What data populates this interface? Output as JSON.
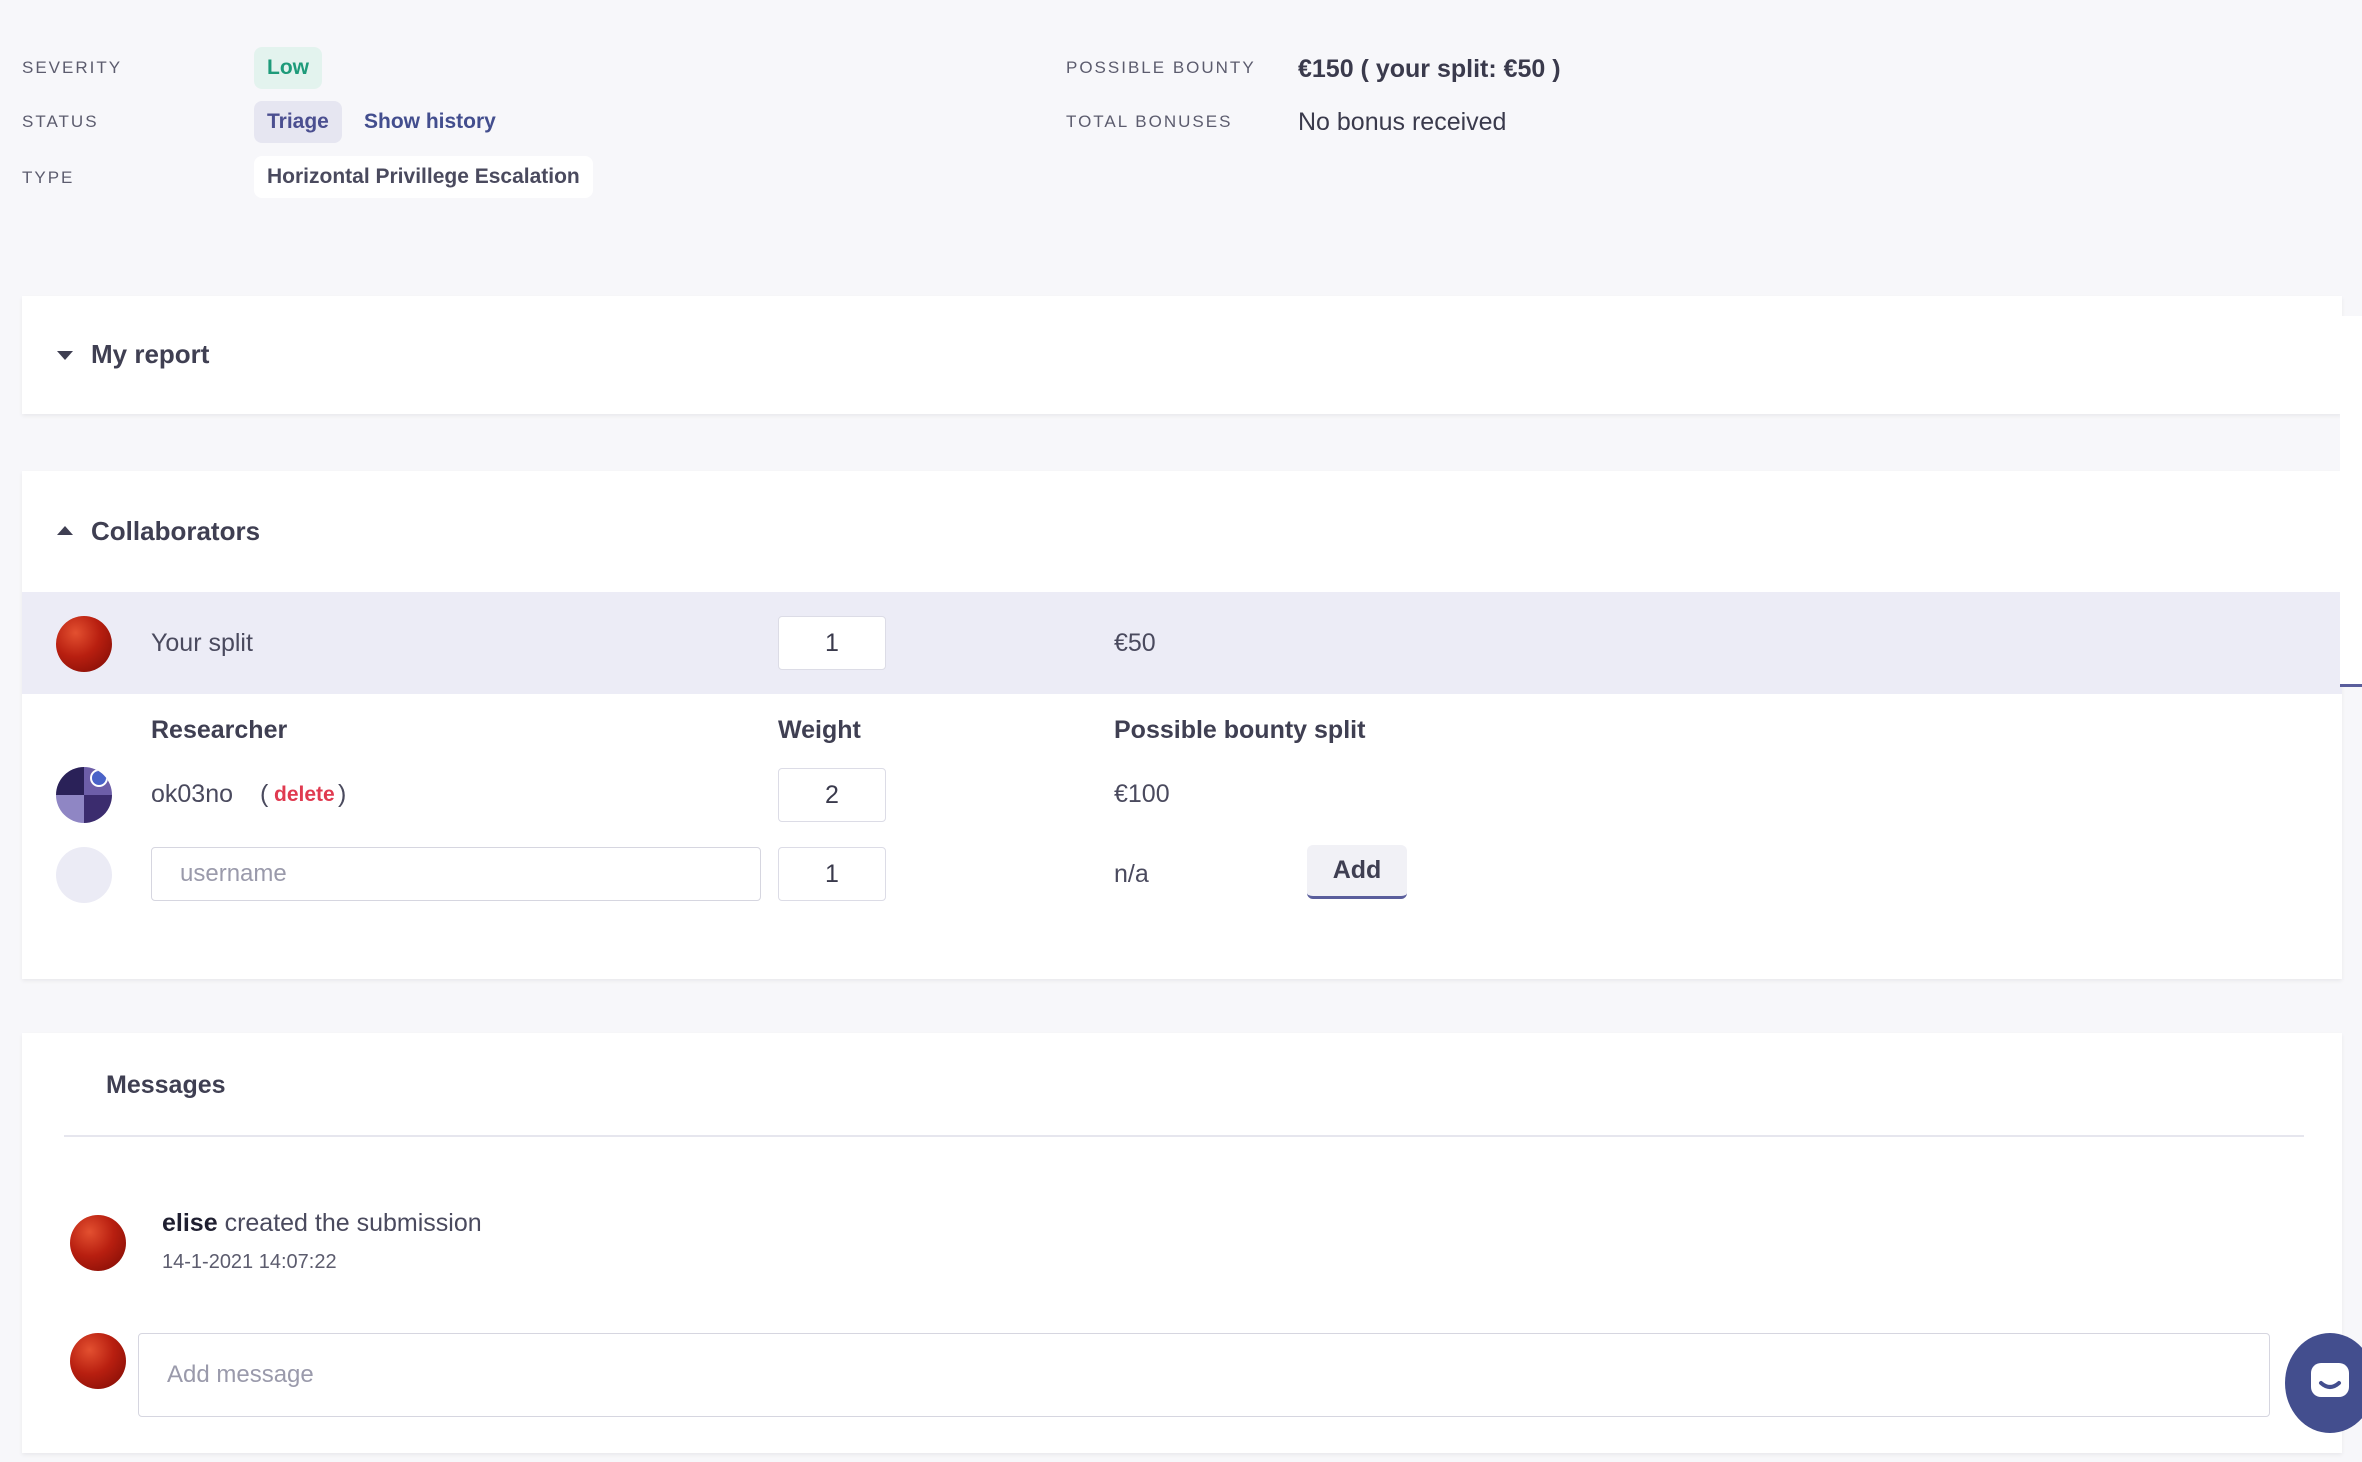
{
  "meta": {
    "severity_label": "SEVERITY",
    "severity_value": "Low",
    "status_label": "STATUS",
    "status_value": "Triage",
    "show_history": "Show history",
    "type_label": "TYPE",
    "type_value": "Horizontal Privillege Escalation",
    "bounty_label": "POSSIBLE BOUNTY",
    "bounty_value": "€150 ( your split: €50 )",
    "bonuses_label": "TOTAL BONUSES",
    "bonuses_value": "No bonus received"
  },
  "my_report": {
    "title": "My report"
  },
  "collaborators": {
    "title": "Collaborators",
    "your_split": {
      "label": "Your split",
      "weight": "1",
      "amount": "€50"
    },
    "headers": {
      "researcher": "Researcher",
      "weight": "Weight",
      "split": "Possible bounty split"
    },
    "rows": [
      {
        "name": "ok03no",
        "delete_open": "(",
        "delete_label": "delete",
        "delete_close": ")",
        "weight": "2",
        "amount": "€100"
      }
    ],
    "new_row": {
      "placeholder": "username",
      "weight": "1",
      "amount": "n/a",
      "add_label": "Add"
    }
  },
  "messages": {
    "title": "Messages",
    "items": [
      {
        "user": "elise",
        "text": "created the submission",
        "timestamp": "14-1-2021 14:07:22"
      }
    ],
    "input_placeholder": "Add message"
  },
  "icons": {
    "chat": "chat-bubble-icon"
  },
  "colors": {
    "accent": "#434e8e",
    "low": "#1e9b7a",
    "danger": "#e03a50"
  }
}
